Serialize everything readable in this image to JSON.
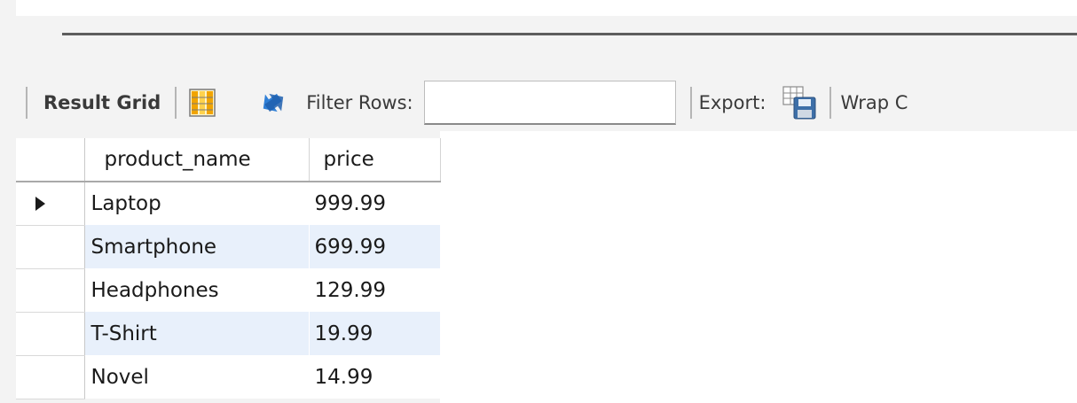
{
  "toolbar": {
    "result_grid_label": "Result Grid",
    "filter_rows_label": "Filter Rows:",
    "filter_rows_value": "",
    "export_label": "Export:",
    "wrap_label": "Wrap C"
  },
  "icons": {
    "form_view": "grid-columns-icon",
    "refresh": "refresh-arrows-icon",
    "export": "save-disk-icon",
    "current_row": "row-pointer-icon"
  },
  "colors": {
    "alt_row": "#e8f0fb",
    "refresh_icon": "#2f7fd6",
    "column_icon": "#f1a400"
  },
  "grid": {
    "columns": [
      "product_name",
      "price"
    ],
    "rows": [
      {
        "product_name": "Laptop",
        "price": "999.99"
      },
      {
        "product_name": "Smartphone",
        "price": "699.99"
      },
      {
        "product_name": "Headphones",
        "price": "129.99"
      },
      {
        "product_name": "T-Shirt",
        "price": "19.99"
      },
      {
        "product_name": "Novel",
        "price": "14.99"
      }
    ]
  }
}
